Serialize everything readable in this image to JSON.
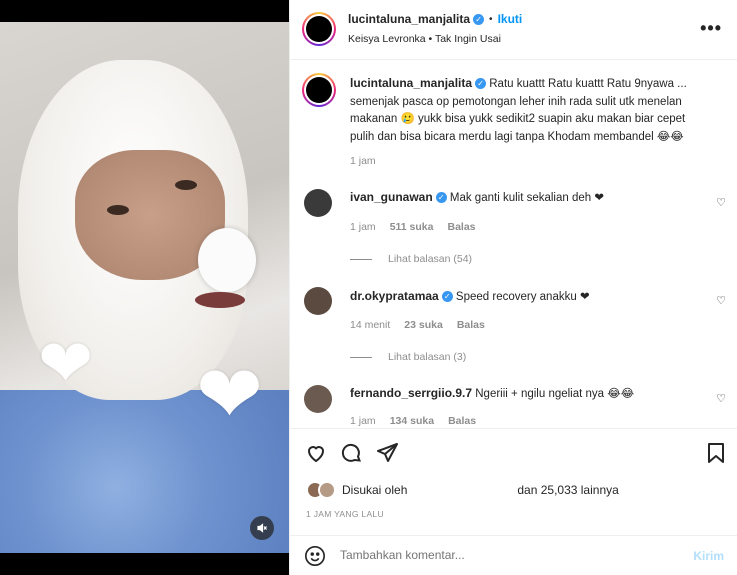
{
  "header": {
    "username": "lucintaluna_manjalita",
    "follow_label": "Ikuti",
    "audio": "Keisya Levronka • Tak Ingin Usai",
    "more": "•••"
  },
  "caption": {
    "username": "lucintaluna_manjalita",
    "text": "Ratu kuattt Ratu kuattt Ratu 9nyawa ... semenjak pasca op pemotongan leher inih rada sulit utk menelan makanan 🥲 yukk bisa yukk sedikit2 suapin aku makan biar cepet pulih dan bisa bicara merdu lagi tanpa Khodam membandel 😂😂",
    "time": "1 jam"
  },
  "comments": [
    {
      "username": "ivan_gunawan",
      "text": "Mak ganti kulit sekalian deh ❤",
      "time": "1 jam",
      "likes": "511 suka",
      "reply": "Balas",
      "view_replies": "Lihat balasan (54)"
    },
    {
      "username": "dr.okypratamaa",
      "text": "Speed recovery anakku ❤",
      "time": "14 menit",
      "likes": "23 suka",
      "reply": "Balas",
      "view_replies": "Lihat balasan (3)"
    },
    {
      "username": "fernando_serrgiio.9.7",
      "text": "Ngeriii + ngilu ngeliat nya 😂😂",
      "time": "1 jam",
      "likes": "134 suka",
      "reply": "Balas"
    }
  ],
  "likes": {
    "liked_by": "Disukai oleh",
    "others": "dan 25,033 lainnya"
  },
  "post_time": "1 JAM YANG LALU",
  "compose": {
    "placeholder": "Tambahkan komentar...",
    "post_label": "Kirim"
  },
  "icons": {
    "like": "heart-icon",
    "comment": "comment-icon",
    "share": "send-icon",
    "save": "bookmark-icon",
    "emoji": "emoji-icon",
    "mute": "mute-icon"
  },
  "colors": {
    "accent": "#0095f6",
    "verified": "#3897f0",
    "muted": "#8e8e8e",
    "post_disabled": "#b2dffc"
  }
}
